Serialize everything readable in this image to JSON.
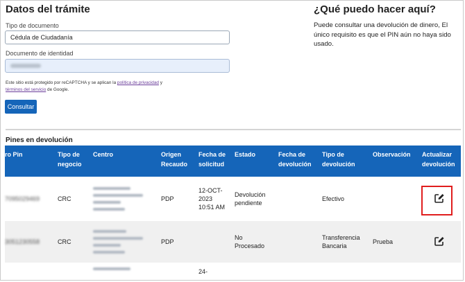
{
  "form": {
    "title": "Datos del trámite",
    "tipo_documento_label": "Tipo de documento",
    "tipo_documento_value": "Cédula de Ciudadanía",
    "documento_identidad_label": "Documento de identidad",
    "recaptcha_text_1": "Este sitio está protegido por reCAPTCHA y se aplican la ",
    "privacy_link": "política de privacidad",
    "recaptcha_text_2": " y",
    "terms_link": "términos del servicio",
    "recaptcha_text_3": " de Google.",
    "consultar_label": "Consultar"
  },
  "help": {
    "title": "¿Qué puedo hacer aquí?",
    "text": "Puede consultar una devolución de dinero, El único requisito es que el PIN aún no haya sido usado."
  },
  "pins": {
    "section_title": "Pines en devolución",
    "columns": [
      "ro Pin",
      "Tipo de negocio",
      "Centro",
      "Origen Recaudo",
      "Fecha de solicitud",
      "Estado",
      "Fecha de devolución",
      "Tipo de devolución",
      "Observación",
      "Actualizar devolución"
    ],
    "rows": [
      {
        "pin": "7095029469",
        "tipo_negocio": "CRC",
        "origen": "PDP",
        "fecha_solicitud": "12-OCT-2023 10:51 AM",
        "estado": "Devolución pendiente",
        "fecha_devolucion": "",
        "tipo_devolucion": "Efectivo",
        "observacion": ""
      },
      {
        "pin": "3051230558",
        "tipo_negocio": "CRC",
        "origen": "PDP",
        "fecha_solicitud": "",
        "estado": "No Procesado",
        "fecha_devolucion": "",
        "tipo_devolucion": "Transferencia Bancaria",
        "observacion": "Prueba"
      },
      {
        "pin": "",
        "tipo_negocio": "",
        "origen": "",
        "fecha_solicitud": "24-",
        "estado": "",
        "fecha_devolucion": "",
        "tipo_devolucion": "",
        "observacion": ""
      }
    ]
  },
  "colors": {
    "primary": "#1565b9",
    "highlight": "#e01d1d"
  },
  "icons": {
    "edit": "edit-icon"
  }
}
